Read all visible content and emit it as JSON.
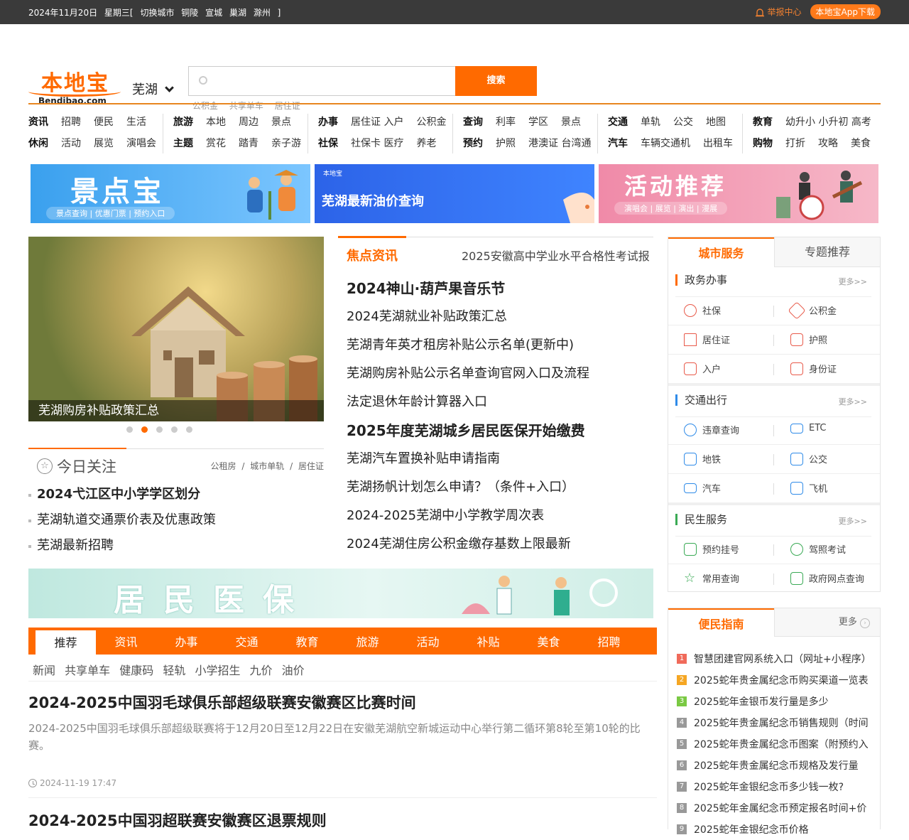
{
  "topbar": {
    "date": "2024年11月20日",
    "weekday": "星期三[",
    "switch_label": "切换城市",
    "cities": [
      "铜陵",
      "宣城",
      "巢湖",
      "滁州"
    ],
    "bracket_close": "]",
    "report": "举报中心",
    "app": "本地宝App下载"
  },
  "logo": {
    "cn": "本地宝",
    "en": "Bendibao.com"
  },
  "city": "芜湖",
  "search": {
    "placeholder": "",
    "button": "搜索",
    "hotwords": [
      "公积金",
      "共享单车",
      "居住证"
    ]
  },
  "nav": [
    {
      "rows": [
        [
          "资讯",
          "招聘",
          "便民",
          "生活"
        ],
        [
          "休闲",
          "活动",
          "展览",
          "演唱会"
        ]
      ]
    },
    {
      "rows": [
        [
          "旅游",
          "本地",
          "周边",
          "景点"
        ],
        [
          "主题",
          "赏花",
          "踏青",
          "亲子游"
        ]
      ]
    },
    {
      "rows": [
        [
          "办事",
          "居住证 入户",
          "公积金"
        ],
        [
          "社保",
          "社保卡 医疗",
          "养老"
        ]
      ]
    },
    {
      "rows": [
        [
          "查询",
          "利率",
          "学区",
          "景点"
        ],
        [
          "预约",
          "护照",
          "港澳证 台湾通"
        ]
      ]
    },
    {
      "rows": [
        [
          "交通",
          "单轨",
          "公交",
          "地图"
        ],
        [
          "汽车",
          "车辆交通机",
          "出租车"
        ]
      ]
    },
    {
      "rows": [
        [
          "教育",
          "幼升小 小升初 高考"
        ],
        [
          "购物",
          "打折",
          "攻略",
          "美食"
        ]
      ]
    }
  ],
  "banners": {
    "b1_title": "景点宝",
    "b1_sub": "景点查询 | 优惠门票 | 预约入口",
    "b2_tag": "本地宝",
    "b2_title": "芜湖最新油价查询",
    "b3_title": "活动推荐",
    "b3_sub": "演唱会 | 展览 | 演出 | 漫展"
  },
  "slide": {
    "caption": "芜湖购房补贴政策汇总",
    "dots": 5,
    "active_dot": 1
  },
  "today": {
    "title": "今日关注",
    "tags": [
      "公租房",
      "/",
      "城市单轨",
      "/",
      "居住证"
    ],
    "items": [
      {
        "text": "2024弋江区中小学学区划分",
        "bold": true
      },
      {
        "text": "芜湖轨道交通票价表及优惠政策",
        "bold": false
      },
      {
        "text": "芜湖最新招聘",
        "bold": false
      }
    ]
  },
  "focus": {
    "title": "焦点资讯",
    "lead": "2025安徽高中学业水平合格性考试报",
    "items": [
      {
        "text": "2024神山·葫芦果音乐节",
        "bold": true
      },
      {
        "text": "2024芜湖就业补贴政策汇总",
        "bold": false
      },
      {
        "text": "芜湖青年英才租房补贴公示名单(更新中)",
        "bold": false
      },
      {
        "text": "芜湖购房补贴公示名单查询官网入口及流程",
        "bold": false
      },
      {
        "text": "法定退休年龄计算器入口",
        "bold": false
      },
      {
        "text": "2025年度芜湖城乡居民医保开始缴费",
        "bold": true
      },
      {
        "text": "芜湖汽车置换补贴申请指南",
        "bold": false
      },
      {
        "text": "芜湖扬帆计划怎么申请？（条件+入口）",
        "bold": false
      },
      {
        "text": "2024-2025芜湖中小学教学周次表",
        "bold": false
      },
      {
        "text": "2024芜湖住房公积金缴存基数上限最新",
        "bold": false
      }
    ]
  },
  "yibao_banner": "居民医保",
  "tabs": [
    "推荐",
    "资讯",
    "办事",
    "交通",
    "教育",
    "旅游",
    "活动",
    "补贴",
    "美食",
    "招聘"
  ],
  "subtabs": [
    "新闻",
    "共享单车",
    "健康码",
    "轻轨",
    "小学招生",
    "九价",
    "油价"
  ],
  "articles": [
    {
      "title": "2024-2025中国羽毛球俱乐部超级联赛安徽赛区比赛时间",
      "summary": "2024-2025中国羽毛球俱乐部超级联赛将于12月20日至12月22日在安徽芜湖航空新城运动中心举行第二循环第8轮至第10轮的比赛。",
      "time": "2024-11-19 17:47"
    },
    {
      "title": "2024-2025中国羽超联赛安徽赛区退票规则"
    }
  ],
  "services": {
    "tab_active": "城市服务",
    "tab_other": "专题推荐",
    "sections": [
      {
        "title": "政务办事",
        "more": "更多>>",
        "items": [
          {
            "label": "社保",
            "icon": "shebao-icon"
          },
          {
            "label": "公积金",
            "icon": "gongjijin-icon"
          },
          {
            "label": "居住证",
            "icon": "house-icon"
          },
          {
            "label": "护照",
            "icon": "passport-icon"
          },
          {
            "label": "入户",
            "icon": "document-icon"
          },
          {
            "label": "身份证",
            "icon": "idcard-icon"
          }
        ]
      },
      {
        "title": "交通出行",
        "more": "更多>>",
        "items": [
          {
            "label": "违章查询",
            "icon": "chart-icon"
          },
          {
            "label": "ETC",
            "icon": "card-icon"
          },
          {
            "label": "地铁",
            "icon": "metro-icon"
          },
          {
            "label": "公交",
            "icon": "bus-icon"
          },
          {
            "label": "汽车",
            "icon": "car-icon"
          },
          {
            "label": "飞机",
            "icon": "plane-icon"
          }
        ]
      },
      {
        "title": "民生服务",
        "more": "更多>>",
        "items": [
          {
            "label": "预约挂号",
            "icon": "medical-icon"
          },
          {
            "label": "驾照考试",
            "icon": "clock-icon"
          },
          {
            "label": "常用查询",
            "icon": "star-icon"
          },
          {
            "label": "政府网点查询",
            "icon": "list-icon"
          }
        ]
      }
    ]
  },
  "guide": {
    "title": "便民指南",
    "more": "更多",
    "items": [
      "智慧团建官网系统入口（网址+小程序）",
      "2025蛇年贵金属纪念币购买渠道一览表",
      "2025蛇年金银币发行量是多少",
      "2025蛇年贵金属纪念币销售规则（时间",
      "2025蛇年贵金属纪念币图案（附预约入",
      "2025蛇年贵金属纪念币规格及发行量",
      "2025蛇年金银纪念币多少钱一枚?",
      "2025蛇年金属纪念币预定报名时间+价",
      "2025蛇年金银纪念币价格"
    ],
    "num_colors": [
      "#f06a5a",
      "#f5a623",
      "#7ac943",
      "#999999",
      "#999999",
      "#999999",
      "#999999",
      "#999999",
      "#999999"
    ]
  },
  "colors": {
    "accent": "#ff6a00",
    "topbar": "#3a3a3a"
  }
}
